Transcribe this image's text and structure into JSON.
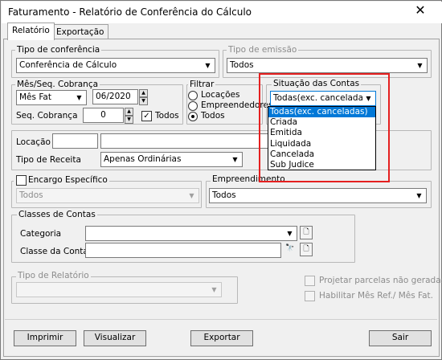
{
  "window": {
    "title": "Faturamento - Relatório de Conferência do Cálculo",
    "close_label": "✕"
  },
  "tabs": [
    {
      "label": "Relatório"
    },
    {
      "label": "Exportação"
    }
  ],
  "tipo_conferencia": {
    "legend": "Tipo de conferência",
    "value": "Conferência de Cálculo"
  },
  "tipo_emissao": {
    "legend": "Tipo de emissão",
    "value": "Todos"
  },
  "mes_seq": {
    "legend": "Mês/Seq. Cobrança",
    "mes_combo": "Mês Fat",
    "mes_value": "06/2020",
    "seq_label": "Seq. Cobrança",
    "seq_value": "0",
    "todos_label": "Todos",
    "todos_checked": "✓"
  },
  "filtrar": {
    "legend": "Filtrar",
    "options": [
      {
        "label": "Locações"
      },
      {
        "label": "Empreendedores"
      },
      {
        "label": "Todos"
      }
    ],
    "selected": "Todos"
  },
  "situacao": {
    "legend": "Situação das Contas",
    "value": "Todas(exc. canceladas",
    "options": [
      "Todas(exc. canceladas)",
      "Criada",
      "Emitida",
      "Liquidada",
      "Cancelada",
      "Sub Judice"
    ]
  },
  "locacao": {
    "label": "Locação",
    "value": ""
  },
  "tipo_receita": {
    "label": "Tipo de Receita",
    "value": "Apenas Ordinárias"
  },
  "encargo": {
    "label": "Encargo Específico",
    "value": "Todos"
  },
  "empreendimento": {
    "legend": "Empreendimento",
    "value": "Todos"
  },
  "classes": {
    "legend": "Classes de Contas",
    "categoria_label": "Categoria",
    "classe_label": "Classe da Conta"
  },
  "tipo_relatorio": {
    "legend": "Tipo de Relatório",
    "value": ""
  },
  "options": {
    "projetar": "Projetar parcelas não geradas",
    "habilitar": "Habilitar Mês Ref./ Mês Fat."
  },
  "buttons": {
    "imprimir": "Imprimir",
    "visualizar": "Visualizar",
    "exportar": "Exportar",
    "sair": "Sair"
  },
  "icons": {
    "combo_arrow": "▼",
    "spin_up": "▲",
    "spin_down": "▼",
    "binoculars": "🔭",
    "doc": "🗋"
  },
  "colors": {
    "selection": "#0078d7",
    "highlight_box": "#e52020"
  }
}
